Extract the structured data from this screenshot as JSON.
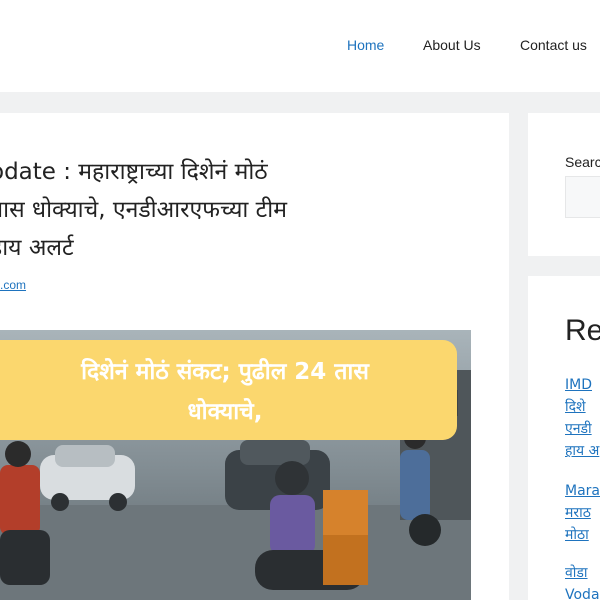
{
  "nav": {
    "items": [
      {
        "label": "Home"
      },
      {
        "label": "About Us"
      },
      {
        "label": "Contact us"
      }
    ]
  },
  "article": {
    "title": "odate : महाराष्ट्राच्या दिशेनं मोठं\nतास धोक्याचे, एनडीआरएफच्या टीम\n हाय अलर्ट",
    "author": ".com",
    "image_caption": "दिशेनं मोठं संकट; पुढील 24 तास\nधोक्याचे,"
  },
  "sidebar": {
    "search": {
      "label": "Searc",
      "value": ""
    },
    "recent": {
      "heading": "Re",
      "posts": [
        {
          "title": "IMD\nदिशे\nएनडी\nहाय अ"
        },
        {
          "title": "Mara\nमराठ\nमोठा"
        },
        {
          "title": "वोडा\nVoda"
        }
      ]
    }
  },
  "colors": {
    "link": "#1e73be",
    "page_background": "#f0f1f2",
    "caption_background": "#fbd76e"
  },
  "icons": []
}
